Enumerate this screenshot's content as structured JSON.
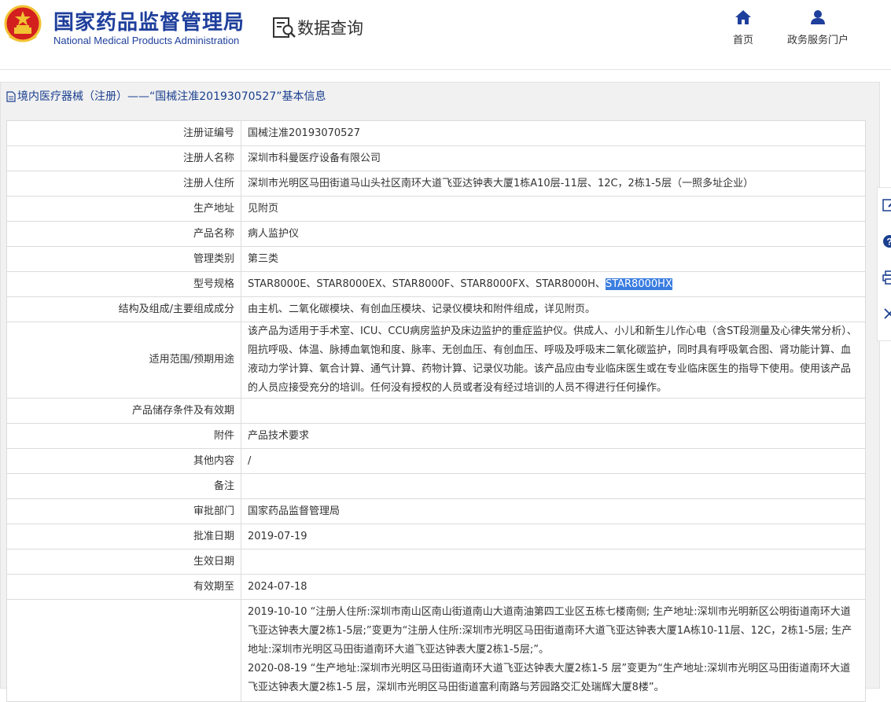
{
  "header": {
    "agency_name_cn": "国家药品监督管理局",
    "agency_name_en": "National Medical Products Administration",
    "query_title": "数据查询",
    "nav": [
      {
        "label": "首页",
        "icon": "home-icon"
      },
      {
        "label": "政务服务门户",
        "icon": "user-icon"
      }
    ]
  },
  "panel": {
    "title": "境内医疗器械（注册）——“国械注准20193070527”基本信息"
  },
  "record": {
    "rows": [
      {
        "label": "注册证编号",
        "value": "国械注准20193070527"
      },
      {
        "label": "注册人名称",
        "value": "深圳市科曼医疗设备有限公司"
      },
      {
        "label": "注册人住所",
        "value": "深圳市光明区马田街道马山头社区南环大道飞亚达钟表大厦1栋A10层-11层、12C，2栋1-5层（一照多址企业）"
      },
      {
        "label": "生产地址",
        "value": "见附页"
      },
      {
        "label": "产品名称",
        "value": "病人监护仪"
      },
      {
        "label": "管理类别",
        "value": "第三类"
      },
      {
        "label": "型号规格",
        "value_pre": "STAR8000E、STAR8000EX、STAR8000F、STAR8000FX、STAR8000H、",
        "value_selected": "STAR8000HX"
      },
      {
        "label": "结构及组成/主要组成成分",
        "value": "由主机、二氧化碳模块、有创血压模块、记录仪模块和附件组成，详见附页。"
      },
      {
        "label": "适用范围/预期用途",
        "value": "该产品为适用于手术室、ICU、CCU病房监护及床边监护的重症监护仪。供成人、小儿和新生儿作心电（含ST段测量及心律失常分析）、阻抗呼吸、体温、脉搏血氧饱和度、脉率、无创血压、有创血压、呼吸及呼吸末二氧化碳监护，同时具有呼吸氧合图、肾功能计算、血液动力学计算、氧合计算、通气计算、药物计算、记录仪功能。该产品应由专业临床医生或在专业临床医生的指导下使用。使用该产品的人员应接受充分的培训。任何没有授权的人员或者没有经过培训的人员不得进行任何操作。"
      },
      {
        "label": "产品储存条件及有效期",
        "value": ""
      },
      {
        "label": "附件",
        "value": "产品技术要求"
      },
      {
        "label": "其他内容",
        "value": "/"
      },
      {
        "label": "备注",
        "value": ""
      },
      {
        "label": "审批部门",
        "value": "国家药品监督管理局"
      },
      {
        "label": "批准日期",
        "value": "2019-07-19"
      },
      {
        "label": "生效日期",
        "value": ""
      },
      {
        "label": "有效期至",
        "value": "2024-07-18"
      },
      {
        "label": "",
        "value_lines": [
          "2019-10-10 “注册人住所:深圳市南山区南山街道南山大道南油第四工业区五栋七楼南侧; 生产地址:深圳市光明新区公明街道南环大道飞亚达钟表大厦2栋1-5层;”变更为“注册人住所:深圳市光明区马田街道南环大道飞亚达钟表大厦1A栋10-11层、12C，2栋1-5层; 生产地址:深圳市光明区马田街道南环大道飞亚达钟表大厦2栋1-5层;”。",
          "2020-08-19 “生产地址:深圳市光明区马田街道南环大道飞亚达钟表大厦2栋1-5 层”变更为“生产地址:深圳市光明区马田街道南环大道飞亚达钟表大厦2栋1-5 层，深圳市光明区马田街道富利南路与芳园路交汇处瑞辉大厦8楼”。"
        ]
      }
    ]
  },
  "side_toolbar": {
    "buttons": [
      "edit-icon",
      "help-icon",
      "print-icon",
      "close-icon"
    ]
  },
  "colors": {
    "brand_blue": "#1f3f9c",
    "link_blue": "#1a3f8f",
    "selection": "#3a7de0",
    "emblem_red": "#d3201f",
    "emblem_gold": "#f1c232"
  }
}
